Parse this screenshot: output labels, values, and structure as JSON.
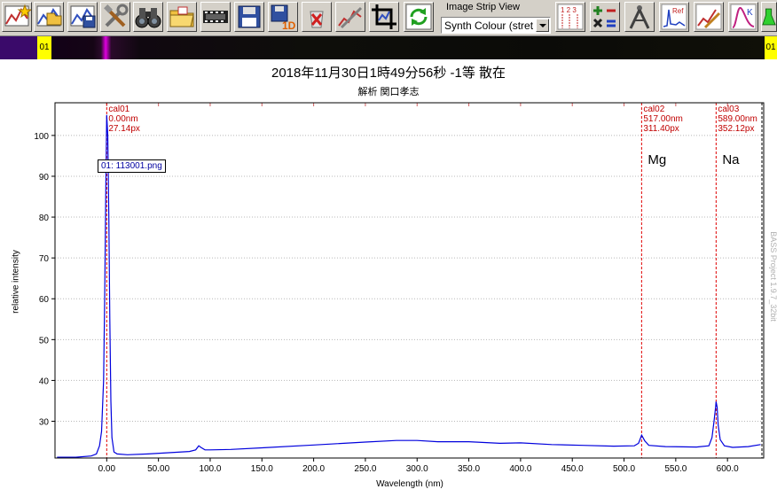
{
  "toolbar": {
    "buttons": [
      {
        "icon": "star-chart-icon"
      },
      {
        "icon": "open-chart-icon"
      },
      {
        "icon": "save-chart-icon"
      },
      {
        "icon": "tools-icon"
      },
      {
        "icon": "binoculars-icon"
      },
      {
        "icon": "open-folder-icon"
      },
      {
        "icon": "film-strip-icon"
      },
      {
        "icon": "floppy-disk-icon"
      },
      {
        "icon": "save-1d-icon",
        "text": "1D"
      },
      {
        "icon": "delete-icon"
      },
      {
        "icon": "calibrate-icon"
      },
      {
        "icon": "crop-icon"
      },
      {
        "icon": "refresh-icon"
      },
      {
        "icon": "numbered-lines-icon",
        "text": "1 2 3"
      },
      {
        "icon": "calculator-icon"
      },
      {
        "icon": "compass-icon"
      },
      {
        "icon": "reference-spectrum-icon",
        "text": "Ref"
      },
      {
        "icon": "edit-graph-icon"
      },
      {
        "icon": "kelvin-curve-icon",
        "text": "K"
      },
      {
        "icon": "flask-icon"
      }
    ],
    "image_strip_label": "Image Strip View",
    "image_strip_mode": "Synth Colour (stretc"
  },
  "image_strip": {
    "marker_left": "01",
    "marker_right": "01"
  },
  "chart_data": {
    "type": "line",
    "title": "2018年11月30日1時49分56秒 -1等 散在",
    "subtitle": "解析 関口孝志",
    "xlabel": "Wavelength (nm)",
    "ylabel": "relative intensity",
    "xlim": [
      -50,
      635
    ],
    "ylim": [
      21,
      108
    ],
    "x_ticks": [
      0,
      50,
      100,
      150,
      200,
      250,
      300,
      350,
      400,
      450,
      500,
      550,
      600
    ],
    "x_tick_labels": [
      "0.00",
      "50.00",
      "100.0",
      "150.0",
      "200.0",
      "250.0",
      "300.0",
      "350.0",
      "400.0",
      "450.0",
      "500.0",
      "550.0",
      "600.0"
    ],
    "y_ticks": [
      30,
      40,
      50,
      60,
      70,
      80,
      90,
      100
    ],
    "y_tick_labels": [
      "30",
      "40",
      "50",
      "60",
      "70",
      "80",
      "90",
      "100"
    ],
    "grid": true,
    "series": [
      {
        "name": "01: 113001.png",
        "color": "#0000dd",
        "points": [
          [
            -48,
            21.2
          ],
          [
            -30,
            21.2
          ],
          [
            -15,
            21.5
          ],
          [
            -10,
            22.0
          ],
          [
            -7,
            24.0
          ],
          [
            -5,
            27.5
          ],
          [
            -3,
            40
          ],
          [
            -2,
            60
          ],
          [
            -1,
            85
          ],
          [
            0,
            105
          ],
          [
            1,
            100
          ],
          [
            2,
            80
          ],
          [
            3,
            55
          ],
          [
            4,
            35
          ],
          [
            5,
            26
          ],
          [
            7,
            22.5
          ],
          [
            10,
            22.0
          ],
          [
            20,
            21.8
          ],
          [
            40,
            22.0
          ],
          [
            60,
            22.3
          ],
          [
            80,
            22.6
          ],
          [
            86,
            23.0
          ],
          [
            89,
            24.0
          ],
          [
            91,
            23.6
          ],
          [
            95,
            23.0
          ],
          [
            100,
            23.0
          ],
          [
            120,
            23.1
          ],
          [
            150,
            23.5
          ],
          [
            200,
            24.2
          ],
          [
            250,
            24.9
          ],
          [
            280,
            25.3
          ],
          [
            300,
            25.3
          ],
          [
            320,
            25.0
          ],
          [
            350,
            25.0
          ],
          [
            380,
            24.6
          ],
          [
            400,
            24.7
          ],
          [
            430,
            24.3
          ],
          [
            460,
            24.1
          ],
          [
            490,
            23.9
          ],
          [
            510,
            24.0
          ],
          [
            514,
            24.6
          ],
          [
            517,
            26.6
          ],
          [
            520,
            25.2
          ],
          [
            524,
            24.1
          ],
          [
            540,
            23.8
          ],
          [
            570,
            23.7
          ],
          [
            582,
            24.0
          ],
          [
            585,
            26.0
          ],
          [
            587,
            30.0
          ],
          [
            588.5,
            33.5
          ],
          [
            589,
            34.8
          ],
          [
            590,
            33.5
          ],
          [
            591,
            29.0
          ],
          [
            593,
            25.5
          ],
          [
            597,
            24.0
          ],
          [
            605,
            23.6
          ],
          [
            620,
            23.8
          ],
          [
            632,
            24.3
          ]
        ]
      }
    ],
    "calibration_lines": [
      {
        "id": "cal01",
        "x": 0,
        "wavelength": "0.00nm",
        "pixel": "27.14px"
      },
      {
        "id": "cal02",
        "x": 517,
        "wavelength": "517.00nm",
        "pixel": "311.40px"
      },
      {
        "id": "cal03",
        "x": 589,
        "wavelength": "589.00nm",
        "pixel": "352.12px"
      }
    ],
    "line_labels": [
      {
        "text": "Mg",
        "x": 517
      },
      {
        "text": "Na",
        "x": 589
      }
    ],
    "legend_label": "01: 113001.png",
    "watermark": "BASS Project 1.9.7_32bit"
  }
}
